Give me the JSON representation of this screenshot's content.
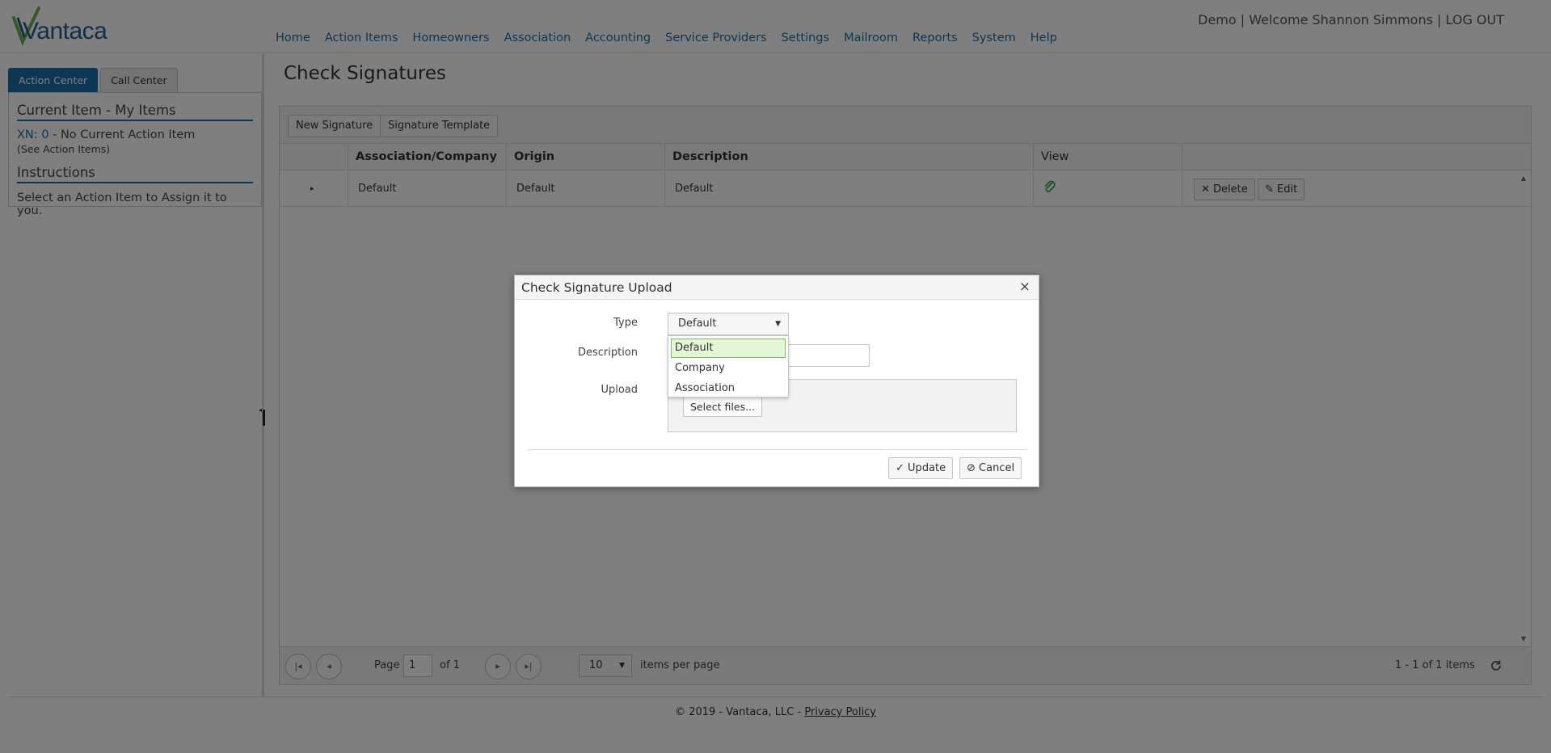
{
  "header": {
    "logo_text": "Vantaca",
    "welcome": "Demo | Welcome Shannon Simmons | LOG OUT",
    "nav": [
      "Home",
      "Action Items",
      "Homeowners",
      "Association",
      "Accounting",
      "Service Providers",
      "Settings",
      "Mailroom",
      "Reports",
      "System",
      "Help"
    ]
  },
  "sidebar": {
    "tabs": [
      "Action Center",
      "Call Center"
    ],
    "current_item_heading": "Current Item - My Items",
    "xn_link": "XN: 0",
    "xn_text": " - No Current Action Item",
    "see_action_items": "(See Action Items)",
    "instructions_heading": "Instructions",
    "instructions_text": "Select an Action Item to Assign it to you."
  },
  "main": {
    "page_title": "Check Signatures",
    "toolbar": {
      "new_signature": "New Signature",
      "signature_template": "Signature Template"
    },
    "columns": [
      "Association/Company",
      "Origin",
      "Description",
      "View"
    ],
    "row": {
      "association": "Default",
      "origin": "Default",
      "description": "Default",
      "delete": "Delete",
      "edit": "Edit"
    },
    "pager": {
      "page_label": "Page",
      "page_value": "1",
      "of_label": "of 1",
      "per_page_value": "10",
      "per_page_label": "items per page",
      "summary": "1 - 1 of 1 items"
    }
  },
  "footer": {
    "copyright": "© 2019 - Vantaca, LLC - ",
    "privacy": "Privacy Policy"
  },
  "modal": {
    "title": "Check Signature Upload",
    "type_label": "Type",
    "type_value": "Default",
    "description_label": "Description",
    "upload_label": "Upload",
    "select_files": "Select files...",
    "update": "Update",
    "cancel": "Cancel",
    "type_options": [
      "Default",
      "Company",
      "Association"
    ],
    "selected_option": "Default"
  },
  "colors": {
    "brand_blue": "#1b6ca8",
    "logo_green": "#6ab04c",
    "selected_green": "#77c25a"
  }
}
